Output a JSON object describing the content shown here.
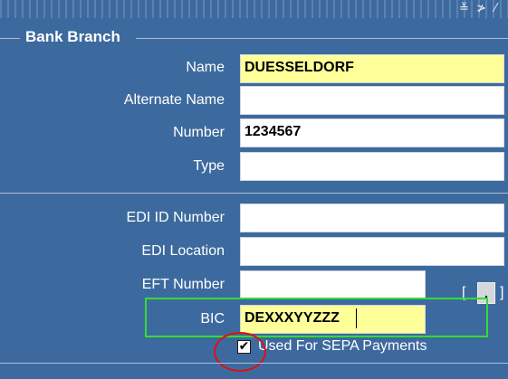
{
  "window": {
    "top_strip_glyphs": [
      "≚",
      "≯",
      "⁄"
    ]
  },
  "section": {
    "title": "Bank Branch"
  },
  "fields": {
    "name": {
      "label": "Name",
      "value": "DUESSELDORF",
      "required": true
    },
    "alternate_name": {
      "label": "Alternate Name",
      "value": ""
    },
    "number": {
      "label": "Number",
      "value": "1234567"
    },
    "type": {
      "label": "Type",
      "value": ""
    },
    "edi_id_number": {
      "label": "EDI ID Number",
      "value": ""
    },
    "edi_location": {
      "label": "EDI Location",
      "value": ""
    },
    "eft_number": {
      "label": "EFT Number",
      "value": ""
    },
    "bic": {
      "label": "BIC",
      "value": "DEXXXYYZZZ",
      "required": true
    }
  },
  "lov": {
    "open_bracket": "[",
    "button_label": ".",
    "close_bracket": "]"
  },
  "sepa": {
    "label": "Used For SEPA Payments",
    "checked": true,
    "check_glyph": "✔"
  },
  "colors": {
    "background": "#3d6a9e",
    "required_field": "#ffff99",
    "annotation_box": "#33dd33",
    "annotation_circle": "#dd1111"
  }
}
